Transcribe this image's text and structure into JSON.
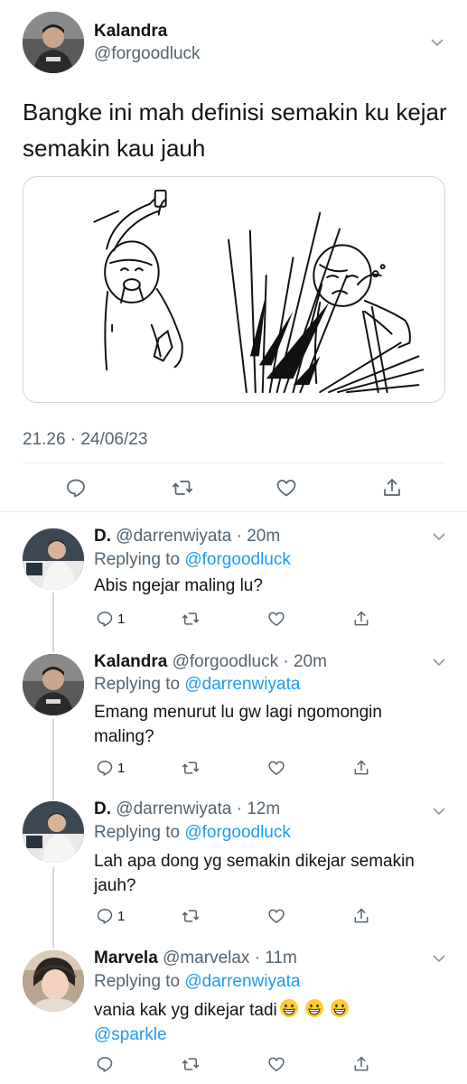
{
  "main_tweet": {
    "name": "Kalandra",
    "handle": "@forgoodluck",
    "text": "Bangke ini mah definisi semakin ku kejar semakin kau jauh",
    "timestamp": "21.26 · 24/06/23",
    "icons": [
      "chevron-down-icon",
      "reply-icon",
      "retweet-icon",
      "like-icon",
      "share-icon"
    ]
  },
  "replies": [
    {
      "name": "D.",
      "meta": "@darrenwiyata · 20m",
      "replying_label": "Replying to ",
      "replying_to": "@forgoodluck",
      "text": "Abis ngejar maling lu?",
      "reply_count": "1"
    },
    {
      "name": "Kalandra",
      "meta": "@forgoodluck · 20m",
      "replying_label": "Replying to ",
      "replying_to": "@darrenwiyata",
      "text": "Emang menurut lu gw lagi ngomongin maling?",
      "reply_count": "1"
    },
    {
      "name": "D.",
      "meta": "@darrenwiyata · 12m",
      "replying_label": "Replying to ",
      "replying_to": "@forgoodluck",
      "text": "Lah apa dong yg semakin dikejar semakin jauh?",
      "reply_count": "1"
    },
    {
      "name": "Marvela",
      "meta": "@marvelax · 11m",
      "replying_label": "Replying to ",
      "replying_to": "@darrenwiyata",
      "text": "vania kak yg dikejar tadi",
      "text_mention": "@sparkle",
      "reply_count": ""
    }
  ],
  "colors": {
    "text": "#0f1419",
    "secondary": "#536471",
    "link": "#1d9bf0",
    "divider": "#e6ecf0"
  }
}
